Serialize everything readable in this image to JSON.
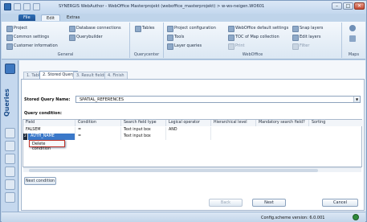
{
  "titlebar": {
    "title": "SYNERGIS WebAuthor - WebOffice Masterprojekt (weboffice_masterprojekt) > w-ws-neigen.WO601",
    "minimize": "–",
    "maximize": "□",
    "close": "✕"
  },
  "menu": {
    "file": "File",
    "edit": "Edit",
    "extras": "Extras"
  },
  "ribbon": {
    "general": {
      "label": "General",
      "items": [
        "Project",
        "Common settings",
        "Customer information",
        "Database connections",
        "Querybuilder"
      ]
    },
    "querycenter": {
      "label": "Querycenter",
      "items": [
        "Tables"
      ]
    },
    "weboffice": {
      "label": "WebOffice",
      "items": [
        "Project configuration",
        "Tools",
        "Layer queries",
        "WebOffice default settings",
        "TOC of Map collection",
        "Print",
        "Snap layers",
        "Edit layers",
        "Filter"
      ]
    },
    "maps": {
      "label": "Maps"
    }
  },
  "sidebar": {
    "title": "Queries"
  },
  "tabs": [
    "1. Table",
    "2. Stored Query",
    "3. Result fields",
    "4. Finish"
  ],
  "form": {
    "stored_query_label": "Stored Query Name:",
    "stored_query_value": "SPATIAL_REFERENCES",
    "query_condition_label": "Query condition:"
  },
  "grid": {
    "columns": [
      "Field",
      "Condition",
      "Search field type",
      "Logical operator",
      "Hierarchical level",
      "Mandatory search field?",
      "Sorting"
    ],
    "rows": [
      {
        "field": "FALSEM",
        "condition": "=",
        "search_type": "Text input box",
        "logical": "AND",
        "level": "",
        "mandatory": "",
        "sorting": ""
      },
      {
        "field": "AUTH_NAME",
        "condition": "=",
        "search_type": "Text input box",
        "logical": "",
        "level": "",
        "mandatory": "",
        "sorting": ""
      }
    ],
    "row_marker": "2"
  },
  "context_menu": {
    "delete": "Delete condition"
  },
  "buttons": {
    "next_condition": "Next condition",
    "back": "Back",
    "next": "Next",
    "cancel": "Cancel"
  },
  "status": {
    "version": "Config.scheme version:  6.0.001"
  }
}
